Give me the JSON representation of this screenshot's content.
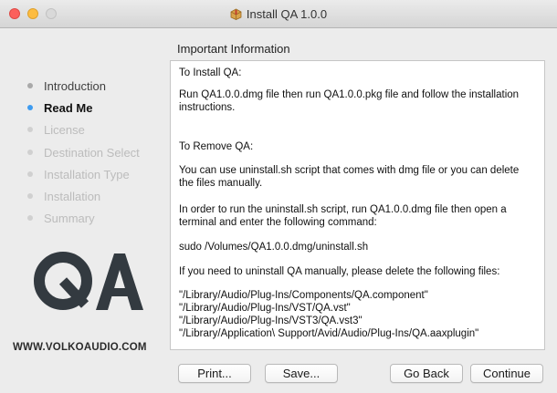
{
  "window": {
    "title": "Install QA 1.0.0",
    "title_icon": "package-icon"
  },
  "sidebar": {
    "steps": [
      {
        "label": "Introduction",
        "state": "done"
      },
      {
        "label": "Read Me",
        "state": "active"
      },
      {
        "label": "License",
        "state": "pending"
      },
      {
        "label": "Destination Select",
        "state": "pending"
      },
      {
        "label": "Installation Type",
        "state": "pending"
      },
      {
        "label": "Installation",
        "state": "pending"
      },
      {
        "label": "Summary",
        "state": "pending"
      }
    ],
    "logo_text": "QA",
    "website": "WWW.VOLKOAUDIO.COM"
  },
  "pane": {
    "header": "Important Information",
    "paragraphs": [
      "To Install QA:",
      "Run QA1.0.0.dmg file then run QA1.0.0.pkg file and follow the installation instructions.",
      "To Remove QA:",
      "You can use uninstall.sh script that comes with dmg file or you can delete the files manually.",
      "In order to run the uninstall.sh script, run QA1.0.0.dmg file then open a terminal and enter the following command:",
      "sudo /Volumes/QA1.0.0.dmg/uninstall.sh",
      "If you need to uninstall QA manually, please delete the following files:",
      "\"/Library/Audio/Plug-Ins/Components/QA.component\"\n\"/Library/Audio/Plug-Ins/VST/QA.vst\"\n\"/Library/Audio/Plug-Ins/VST3/QA.vst3\"\n\"/Library/Application\\ Support/Avid/Audio/Plug-Ins/QA.aaxplugin\""
    ]
  },
  "buttons": {
    "print": "Print...",
    "save": "Save...",
    "go_back": "Go Back",
    "continue": "Continue"
  },
  "colors": {
    "active_step": "#3e9bf0",
    "close": "#fc605c",
    "minimize": "#fdbc40"
  }
}
